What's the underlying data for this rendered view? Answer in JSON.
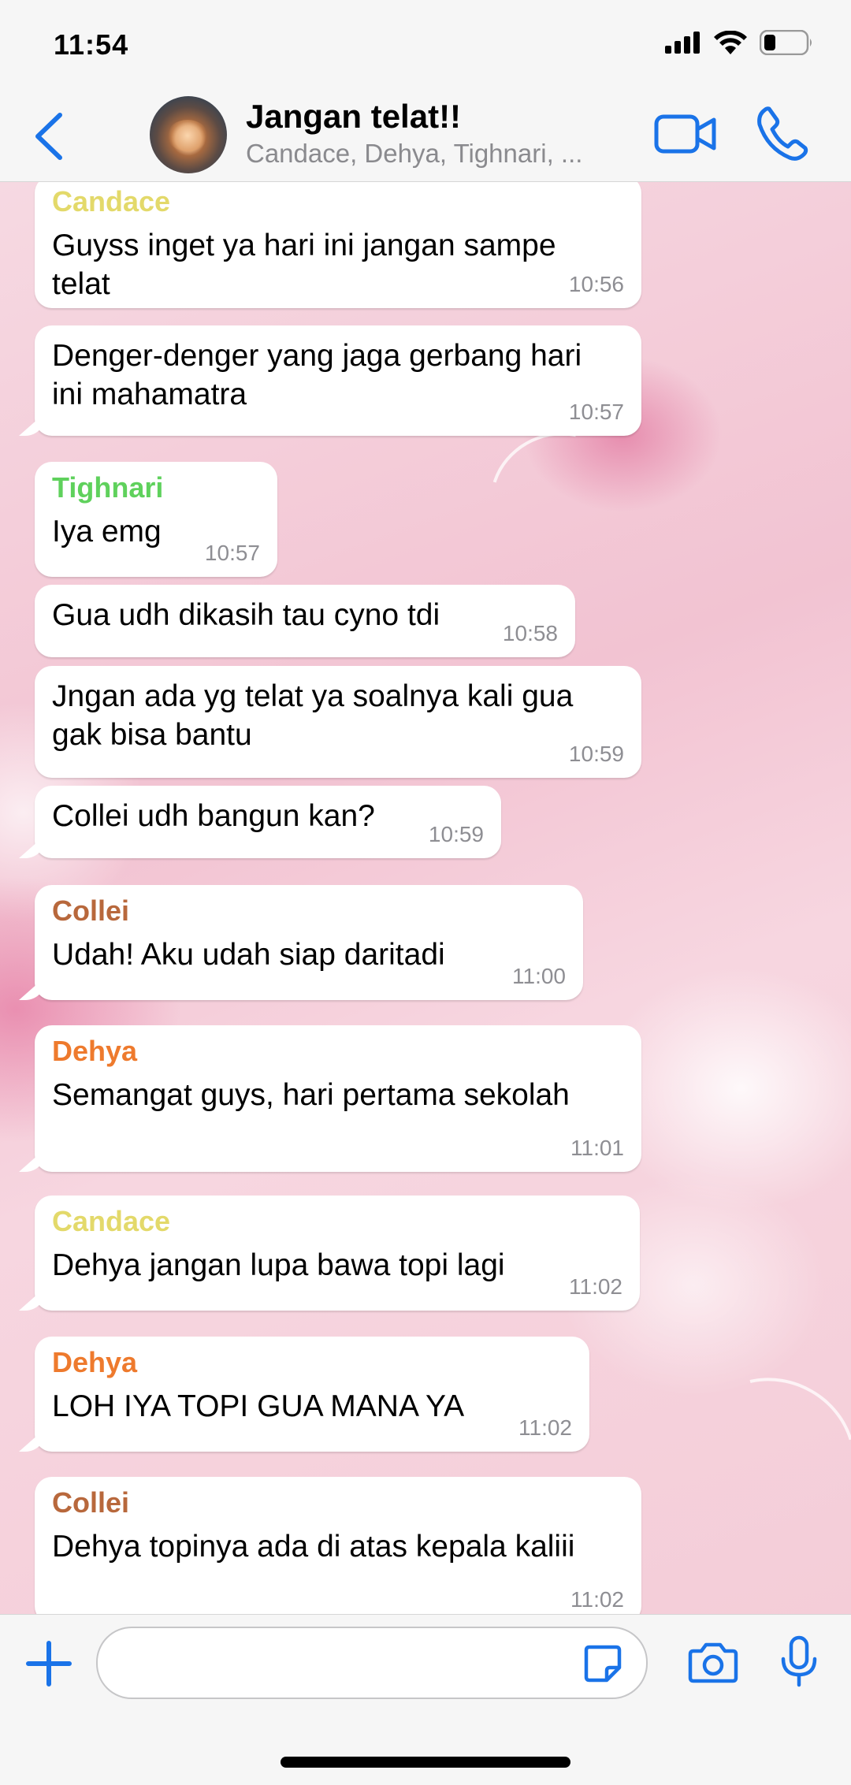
{
  "status_bar": {
    "time": "11:54"
  },
  "header": {
    "title": "Jangan telat!!",
    "subtitle": "Candace, Dehya, Tighnari, ..."
  },
  "colors": {
    "accent": "#1a73e8",
    "candace": "#e3d96a",
    "tighnari": "#5fd15c",
    "collei": "#b8683c",
    "dehya": "#ee7a2d",
    "timestamp": "#8e8e93"
  },
  "messages": [
    {
      "sender": "Candace",
      "text": [
        "Guyss inget ya hari ini jangan sampe",
        "telat"
      ],
      "time": "10:56"
    },
    {
      "sender": "",
      "text": [
        "Denger-denger yang jaga gerbang hari",
        "ini mahamatra"
      ],
      "time": "10:57"
    },
    {
      "sender": "Tighnari",
      "text": [
        "Iya emg"
      ],
      "time": "10:57"
    },
    {
      "sender": "",
      "text": [
        "Gua udh dikasih tau cyno tdi"
      ],
      "time": "10:58"
    },
    {
      "sender": "",
      "text": [
        "Jngan ada yg telat ya soalnya kali gua",
        "gak bisa bantu"
      ],
      "time": "10:59"
    },
    {
      "sender": "",
      "text": [
        "Collei udh bangun kan?"
      ],
      "time": "10:59"
    },
    {
      "sender": "Collei",
      "text": [
        "Udah! Aku udah siap daritadi"
      ],
      "time": "11:00"
    },
    {
      "sender": "Dehya",
      "text": [
        "Semangat guys, hari pertama sekolah"
      ],
      "time": "11:01"
    },
    {
      "sender": "Candace",
      "text": [
        "Dehya jangan lupa bawa topi lagi"
      ],
      "time": "11:02"
    },
    {
      "sender": "Dehya",
      "text": [
        "LOH IYA TOPI GUA MANA YA"
      ],
      "time": "11:02"
    },
    {
      "sender": "Collei",
      "text": [
        "Dehya topinya ada di atas kepala kaliii"
      ],
      "time": "11:02"
    }
  ],
  "composer": {
    "placeholder": ""
  },
  "icons": {
    "back": "chevron-left-icon",
    "video": "video-camera-icon",
    "call": "phone-icon",
    "plus": "plus-icon",
    "sticker": "sticker-icon",
    "camera": "camera-icon",
    "mic": "microphone-icon"
  }
}
